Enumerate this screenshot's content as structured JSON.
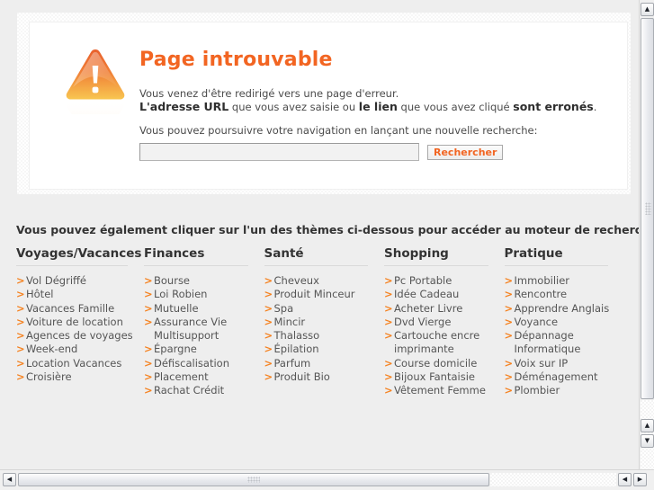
{
  "error_panel": {
    "icon": "warning-triangle-icon",
    "title": "Page introuvable",
    "line1": "Vous venez d'être redirigé vers une page d'erreur.",
    "line2_part1": "L'adresse URL",
    "line2_part2": " que vous avez saisie ou ",
    "line2_part3": "le lien",
    "line2_part4": " que vous avez cliqué ",
    "line2_part5": "sont erronés",
    "line2_part6": ".",
    "line3": "Vous pouvez poursuivre votre navigation en lançant une nouvelle recherche:",
    "search_value": "",
    "search_placeholder": "",
    "search_button": "Rechercher",
    "accent_color": "#f26522"
  },
  "themes": {
    "intro": "Vous pouvez également cliquer sur l'un des thèmes ci-dessous pour accéder au moteur de recherche :",
    "columns": [
      {
        "title": "Voyages/Vacances",
        "links": [
          "Vol Dégriffé",
          "Hôtel",
          "Vacances Famille",
          "Voiture de location",
          "Agences de voyages",
          "Week-end",
          "Location Vacances",
          "Croisière"
        ]
      },
      {
        "title": "Finances",
        "links": [
          "Bourse",
          "Loi Robien",
          "Mutuelle",
          "Assurance Vie Multisupport",
          "Épargne",
          "Défiscalisation",
          "Placement",
          "Rachat Crédit"
        ]
      },
      {
        "title": "Santé",
        "links": [
          "Cheveux",
          "Produit Minceur",
          "Spa",
          "Mincir",
          "Thalasso",
          "Épilation",
          "Parfum",
          "Produit Bio"
        ]
      },
      {
        "title": "Shopping",
        "links": [
          "Pc Portable",
          "Idée Cadeau",
          "Acheter Livre",
          "Dvd Vierge",
          "Cartouche encre imprimante",
          "Course domicile",
          "Bijoux Fantaisie",
          "Vêtement Femme"
        ]
      },
      {
        "title": "Pratique",
        "links": [
          "Immobilier",
          "Rencontre",
          "Apprendre Anglais",
          "Voyance",
          "Dépannage Informatique",
          "Voix sur IP",
          "Déménagement",
          "Plombier"
        ]
      }
    ]
  },
  "scrollbars": {
    "v_up_glyph": "▲",
    "v_down_glyph": "▼",
    "h_left_glyph": "◀",
    "h_right_glyph": "▶"
  }
}
